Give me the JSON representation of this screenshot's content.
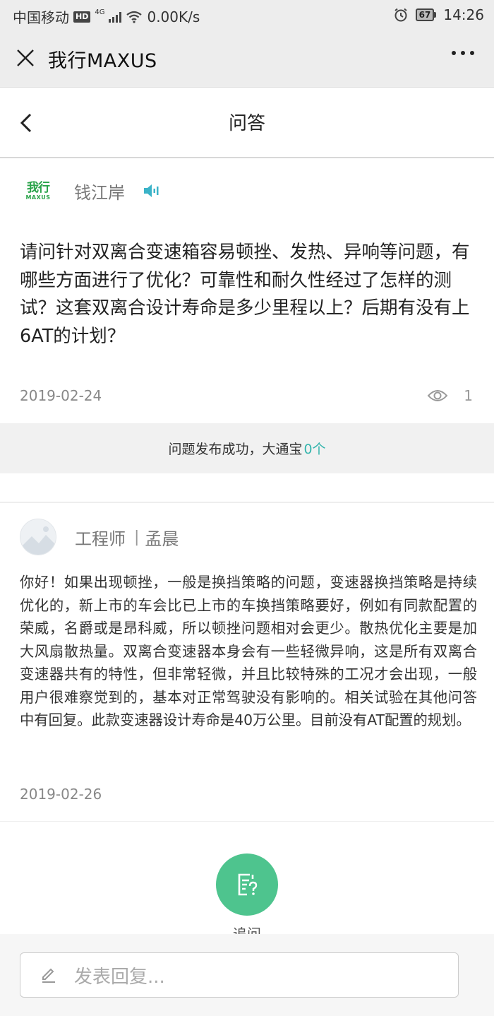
{
  "status_bar": {
    "carrier": "中国移动",
    "hd": "HD",
    "network": "4G",
    "speed": "0.00K/s",
    "battery": "67",
    "time": "14:26"
  },
  "titlebar": {
    "title": "我行MAXUS"
  },
  "page_header": {
    "title": "问答"
  },
  "question": {
    "logo_cn": "我行",
    "logo_en": "MAXUS",
    "author": "钱江岸",
    "text": "请问针对双离合变速箱容易顿挫、发热、异响等问题，有哪些方面进行了优化？可靠性和耐久性经过了怎样的测试？这套双离合设计寿命是多少里程以上？后期有没有上6AT的计划？",
    "date": "2019-02-24",
    "views": "1"
  },
  "banner": {
    "text": "问题发布成功，大通宝",
    "count": "0个"
  },
  "answer": {
    "role": "工程师",
    "separator": "|",
    "name": "孟晨",
    "text": "你好！如果出现顿挫，一般是换挡策略的问题，变速器换挡策略是持续优化的，新上市的车会比已上市的车换挡策略要好，例如有同款配置的荣威，名爵或是昂科威，所以顿挫问题相对会更少。散热优化主要是加大风扇散热量。双离合变速器本身会有一些轻微异响，这是所有双离合变速器共有的特性，但非常轻微，并且比较特殊的工况才会出现，一般用户很难察觉到的，基本对正常驾驶没有影响的。相关试验在其他问答中有回复。此款变速器设计寿命是40万公里。目前没有AT配置的规划。",
    "date": "2019-02-26"
  },
  "followup": {
    "label": "追问"
  },
  "reply": {
    "placeholder": "发表回复..."
  },
  "colors": {
    "accent": "#35b5ad",
    "followup_button": "#4ec48e",
    "logo_green": "#2aa34a"
  },
  "icons": [
    "close-icon",
    "more-icon",
    "back-icon",
    "speaker-icon",
    "eye-icon",
    "question-note-icon",
    "pencil-icon"
  ]
}
